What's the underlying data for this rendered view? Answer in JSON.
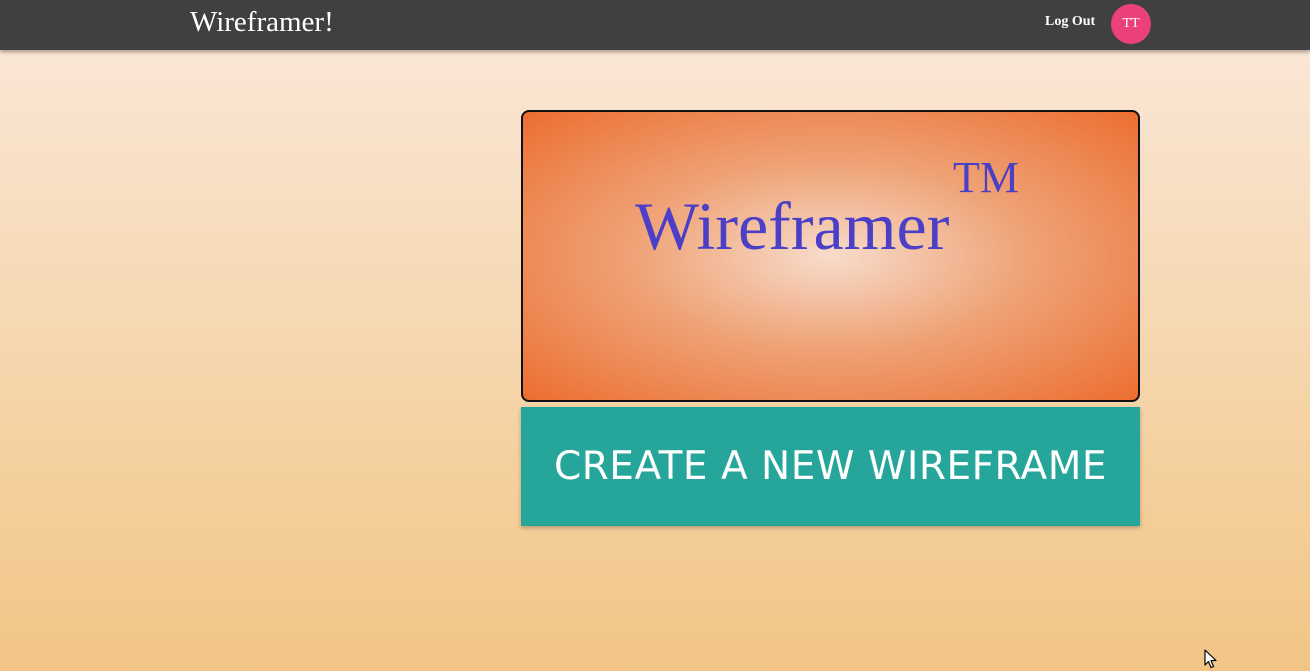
{
  "navbar": {
    "brand": "Wireframer!",
    "logout_label": "Log Out",
    "avatar_initials": "TT",
    "avatar_color": "#ec407a",
    "background_color": "#404040"
  },
  "banner": {
    "title": "Wireframer",
    "trademark": "TM",
    "title_color": "#4a3fc6"
  },
  "create_button": {
    "label": "CREATE A NEW WIREFRAME",
    "color": "#26a69a"
  }
}
